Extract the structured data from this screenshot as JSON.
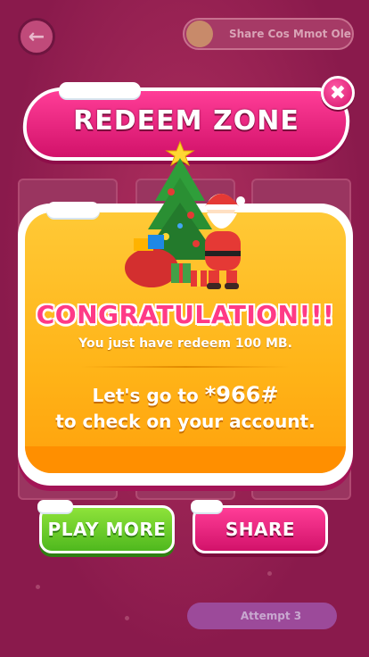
{
  "background": {
    "back_icon": "arrow-left-icon",
    "top_pill_label": "Share Cos Mmot Ole",
    "bottom_pill_label": "Attempt 3"
  },
  "popup": {
    "title": "REDEEM ZONE",
    "close_icon": "close-icon",
    "congrats_text": "CONGRATULATION!!!",
    "redeem_text": "You just have redeem 100 MB.",
    "dial_prefix": "Let's go to ",
    "dial_code": "*966#",
    "account_text": "to check on your account.",
    "illustration": "santa-christmas-tree-gifts"
  },
  "buttons": {
    "play_more": "PLAY MORE",
    "share": "SHARE"
  },
  "colors": {
    "pink": "#e91e7a",
    "orange": "#ffb418",
    "green": "#5cc223",
    "congrats_pink": "#ff3a86"
  }
}
